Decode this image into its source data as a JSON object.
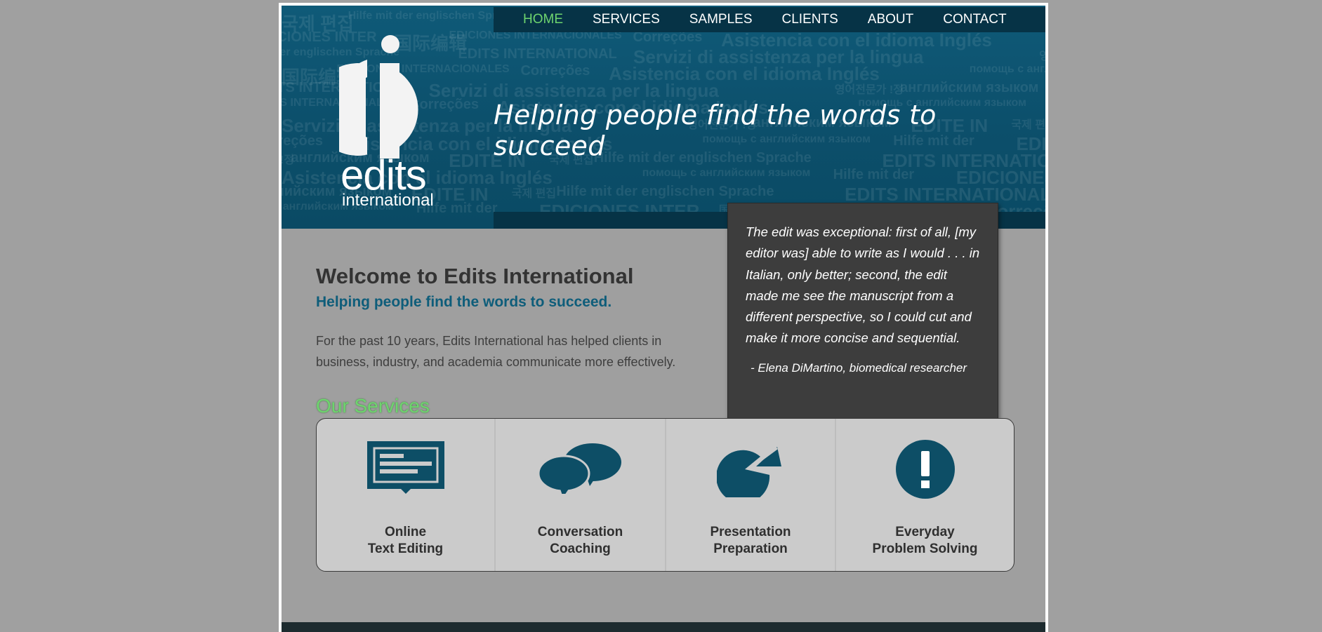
{
  "nav": {
    "items": [
      {
        "label": "HOME",
        "active": true
      },
      {
        "label": "SERVICES",
        "active": false
      },
      {
        "label": "SAMPLES",
        "active": false
      },
      {
        "label": "CLIENTS",
        "active": false
      },
      {
        "label": "ABOUT",
        "active": false
      },
      {
        "label": "CONTACT",
        "active": false
      }
    ],
    "active_color": "#6ed46e"
  },
  "header": {
    "tagline": "Helping people find the words to succeed",
    "logo": {
      "line1": "edits",
      "line2": "international",
      "icon": "ei-logo-icon"
    },
    "background_words": [
      "국제 편집",
      "EDICIONES INTER",
      "Hilfe mit der englischen Sprache",
      "国际编辑",
      "EDITS INTERNATIONAL",
      "EDICIONES INTERNACIONALES",
      "Servizi di assistenza per la lingua",
      "Correções",
      "영어전문가 !정",
      "Asistencia con el idioma Inglés",
      "английским языком",
      "помощь с английским языком",
      "EDITE IN",
      "Hilfe mit der"
    ]
  },
  "testimonial": {
    "quote": "The edit was exceptional: first of all, [my editor was] able to write as I would . . . in Italian, only better; second, the edit made me see the manuscript from a different perspective, so I could cut and make it more concise and sequential.",
    "author": "- Elena DiMartino, biomedical researcher"
  },
  "main": {
    "title": "Welcome to Edits International",
    "subtitle": "Helping people find the words to succeed.",
    "intro": "For the past 10 years, Edits International has helped clients in business, industry, and academia communicate more effectively.",
    "services_heading": "Our Services"
  },
  "services": [
    {
      "line1": "Online",
      "line2": "Text Editing",
      "icon": "monitor-icon"
    },
    {
      "line1": "Conversation",
      "line2": "Coaching",
      "icon": "speech-bubbles-icon"
    },
    {
      "line1": "Presentation",
      "line2": "Preparation",
      "icon": "pie-chart-icon"
    },
    {
      "line1": "Everyday",
      "line2": "Problem Solving",
      "icon": "exclamation-icon"
    }
  ],
  "colors": {
    "brand_teal": "#0c4f6b",
    "dark_navy": "#063346",
    "icon_teal": "#0d4e66",
    "accent_green": "#6ed46e",
    "page_gray": "#9f9f9f"
  }
}
